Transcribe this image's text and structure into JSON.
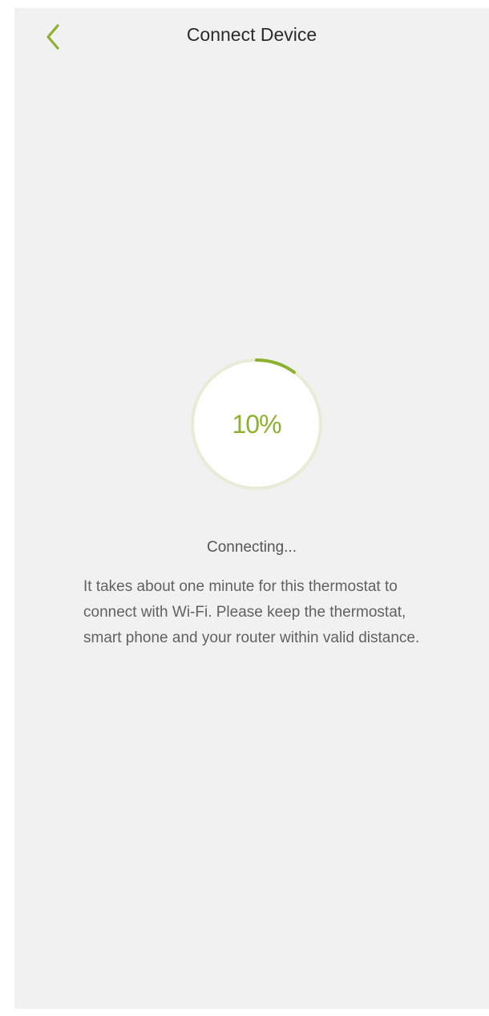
{
  "header": {
    "back_icon": "chevron-left-icon",
    "title": "Connect Device"
  },
  "progress": {
    "percent": 10,
    "label": "10%"
  },
  "status": {
    "text": "Connecting..."
  },
  "description": {
    "text": "It takes about one minute for this thermostat to connect with Wi-Fi. Please keep the thermostat, smart phone and your router within valid distance."
  },
  "colors": {
    "accent": "#8cb22d",
    "background": "#f1f1f1",
    "ring_track": "#e7ecd6",
    "circle_fill": "#ffffff"
  }
}
